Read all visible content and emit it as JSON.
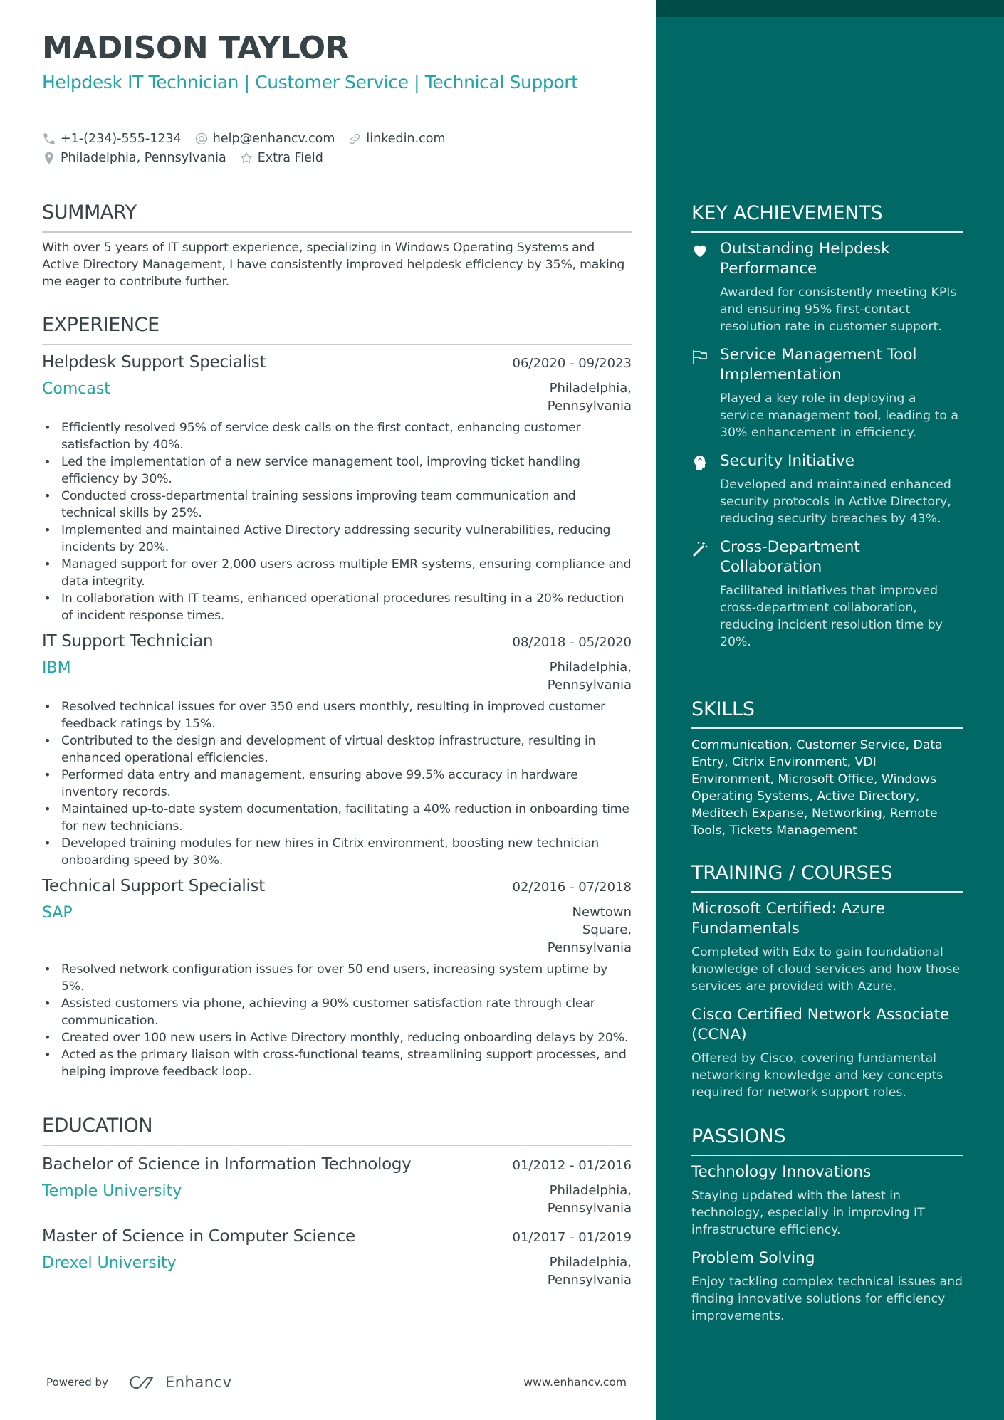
{
  "header": {
    "name": "MADISON TAYLOR",
    "title": "Helpdesk IT Technician | Customer Service | Technical Support",
    "contacts": [
      {
        "icon": "phone-icon",
        "text": "+1-(234)-555-1234"
      },
      {
        "icon": "at-icon",
        "text": "help@enhancv.com"
      },
      {
        "icon": "link-icon",
        "text": "linkedin.com"
      },
      {
        "icon": "location-pin-icon",
        "text": "Philadelphia, Pennsylvania"
      },
      {
        "icon": "star-icon",
        "text": "Extra Field"
      }
    ]
  },
  "summary": {
    "heading": "SUMMARY",
    "text": "With over 5 years of IT support experience, specializing in Windows Operating Systems and Active Directory Management, I have consistently improved helpdesk efficiency by 35%, making me eager to contribute further."
  },
  "experience": {
    "heading": "EXPERIENCE",
    "items": [
      {
        "role": "Helpdesk Support Specialist",
        "dates": "06/2020 - 09/2023",
        "company": "Comcast",
        "location": "Philadelphia, Pennsylvania",
        "bullets": [
          "Efficiently resolved 95% of service desk calls on the first contact, enhancing customer satisfaction by 40%.",
          "Led the implementation of a new service management tool, improving ticket handling efficiency by 30%.",
          "Conducted cross-departmental training sessions improving team communication and technical skills by 25%.",
          "Implemented and maintained Active Directory addressing security vulnerabilities, reducing incidents by 20%.",
          "Managed support for over 2,000 users across multiple EMR systems, ensuring compliance and data integrity.",
          "In collaboration with IT teams, enhanced operational procedures resulting in a 20% reduction of incident response times."
        ]
      },
      {
        "role": "IT Support Technician",
        "dates": "08/2018 - 05/2020",
        "company": "IBM",
        "location": "Philadelphia, Pennsylvania",
        "bullets": [
          "Resolved technical issues for over 350 end users monthly, resulting in improved customer feedback ratings by 15%.",
          "Contributed to the design and development of virtual desktop infrastructure, resulting in enhanced operational efficiencies.",
          "Performed data entry and management, ensuring above 99.5% accuracy in hardware inventory records.",
          "Maintained up-to-date system documentation, facilitating a 40% reduction in onboarding time for new technicians.",
          "Developed training modules for new hires in Citrix environment, boosting new technician onboarding speed by 30%."
        ]
      },
      {
        "role": "Technical Support Specialist",
        "dates": "02/2016 - 07/2018",
        "company": "SAP",
        "location": "Newtown Square, Pennsylvania",
        "bullets": [
          "Resolved network configuration issues for over 50 end users, increasing system uptime by 5%.",
          "Assisted customers via phone, achieving a 90% customer satisfaction rate through clear communication.",
          "Created over 100 new users in Active Directory monthly, reducing onboarding delays by 20%.",
          "Acted as the primary liaison with cross-functional teams, streamlining support processes, and helping improve feedback loop."
        ]
      }
    ]
  },
  "education": {
    "heading": "EDUCATION",
    "items": [
      {
        "degree": "Bachelor of Science in Information Technology",
        "dates": "01/2012 - 01/2016",
        "school": "Temple University",
        "location": "Philadelphia, Pennsylvania"
      },
      {
        "degree": "Master of Science in Computer Science",
        "dates": "01/2017 - 01/2019",
        "school": "Drexel University",
        "location": "Philadelphia, Pennsylvania"
      }
    ]
  },
  "footer": {
    "powered_by": "Powered by",
    "brand": "Enhancv",
    "site": "www.enhancv.com"
  },
  "achievements": {
    "heading": "KEY ACHIEVEMENTS",
    "items": [
      {
        "icon": "heart-icon",
        "title": "Outstanding Helpdesk Performance",
        "desc": "Awarded for consistently meeting KPIs and ensuring 95% first-contact resolution rate in customer support."
      },
      {
        "icon": "flag-icon",
        "title": "Service Management Tool Implementation",
        "desc": "Played a key role in deploying a service management tool, leading to a 30% enhancement in efficiency."
      },
      {
        "icon": "brain-head-icon",
        "title": "Security Initiative",
        "desc": "Developed and maintained enhanced security protocols in Active Directory, reducing security breaches by 43%."
      },
      {
        "icon": "magic-wand-icon",
        "title": "Cross-Department Collaboration",
        "desc": "Facilitated initiatives that improved cross-department collaboration, reducing incident resolution time by 20%."
      }
    ]
  },
  "skills": {
    "heading": "SKILLS",
    "text": "Communication, Customer Service, Data Entry, Citrix Environment, VDI Environment, Microsoft Office, Windows Operating Systems, Active Directory, Meditech Expanse, Networking, Remote Tools, Tickets Management"
  },
  "training": {
    "heading": "TRAINING / COURSES",
    "items": [
      {
        "title": "Microsoft Certified: Azure Fundamentals",
        "desc": "Completed with Edx to gain foundational knowledge of cloud services and how those services are provided with Azure."
      },
      {
        "title": "Cisco Certified Network Associate (CCNA)",
        "desc": "Offered by Cisco, covering fundamental networking knowledge and key concepts required for network support roles."
      }
    ]
  },
  "passions": {
    "heading": "PASSIONS",
    "items": [
      {
        "title": "Technology Innovations",
        "desc": "Staying updated with the latest in technology, especially in improving IT infrastructure efficiency."
      },
      {
        "title": "Problem Solving",
        "desc": "Enjoy tackling complex technical issues and finding innovative solutions for efficiency improvements."
      }
    ]
  },
  "colors": {
    "accent": "#1fa6a6",
    "text": "#384347",
    "sidebar": "#006865",
    "sidebar_top": "#004c4a"
  }
}
